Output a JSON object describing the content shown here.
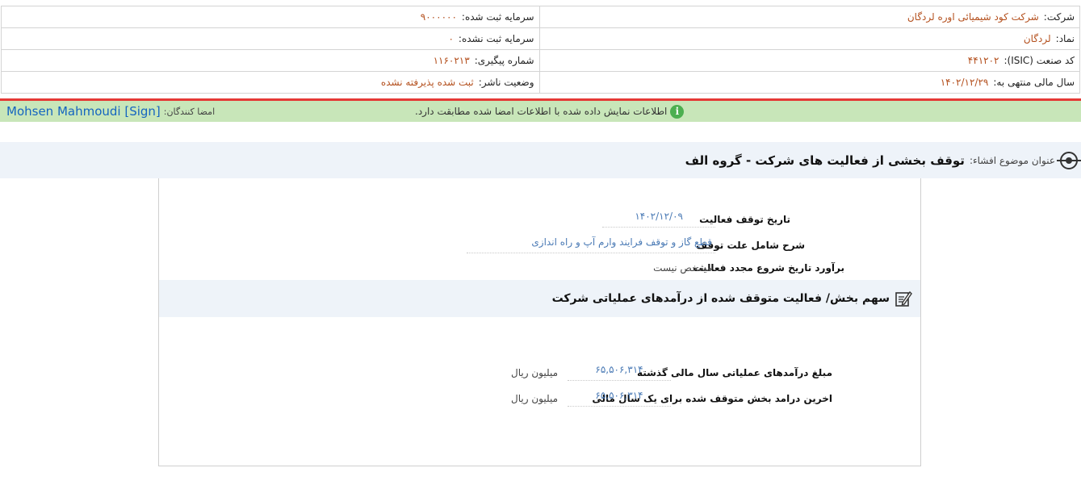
{
  "company_info": {
    "company_label": "شرکت:",
    "company_value": "شرکت کود شیمیائی اوره لردگان",
    "capital_label": "سرمایه ثبت شده:",
    "capital_value": "۹۰۰۰۰۰۰",
    "symbol_label": "نماد:",
    "symbol_value": "لردگان",
    "unregistered_capital_label": "سرمایه ثبت نشده:",
    "unregistered_capital_value": "۰",
    "isic_label": "کد صنعت (ISIC):",
    "isic_value": "۴۴۱۲۰۲",
    "tracking_label": "شماره پیگیری:",
    "tracking_value": "۱۱۶۰۲۱۳",
    "fiscal_year_label": "سال مالی منتهی به:",
    "fiscal_year_value": "۱۴۰۲/۱۲/۲۹",
    "publisher_status_label": "وضعیت ناشر:",
    "publisher_status_value": "ثبت شده پذیرفته نشده"
  },
  "sign_bar": {
    "signers_label": "امضا کنندگان:",
    "signers_name": "Mohsen Mahmoudi [Sign]",
    "notice": "اطلاعات نمایش داده شده با اطلاعات امضا شده مطابقت دارد."
  },
  "subject": {
    "label": "عنوان موضوع افشاء:",
    "title": "توقف بخشی از فعالیت های شرکت - گروه الف"
  },
  "details": {
    "stop_date_label": "تاریخ توقف فعالیت",
    "stop_date_value": "۱۴۰۲/۱۲/۰۹",
    "reason_label": "شرح شامل علت توقف",
    "reason_value": "قطع گاز و توقف فرایند وارم آپ و راه اندازی",
    "restart_label": "برآورد تاریخ شروع مجدد فعالیت",
    "restart_value": "مشخص نیست"
  },
  "revenue_section": {
    "title": "سهم بخش/ فعالیت متوقف شده از درآمدهای عملیاتی شرکت",
    "rows": [
      {
        "label": "مبلغ درآمدهای عملیاتی سال مالی گذشته",
        "value": "۶۵,۵۰۶,۳۱۴",
        "unit": "میلیون ریال"
      },
      {
        "label": "اخرین درامد بخش متوقف شده برای یک سال مالی",
        "value": "۶۵,۵۰۶,۳۱۴",
        "unit": "میلیون ریال"
      }
    ]
  },
  "colors": {
    "accent_value": "#b4501e",
    "link_blue": "#4a7ab5",
    "sign_bar_bg": "#c8e6b9",
    "red_divider": "#e53935",
    "section_bg": "#eef3f9"
  }
}
